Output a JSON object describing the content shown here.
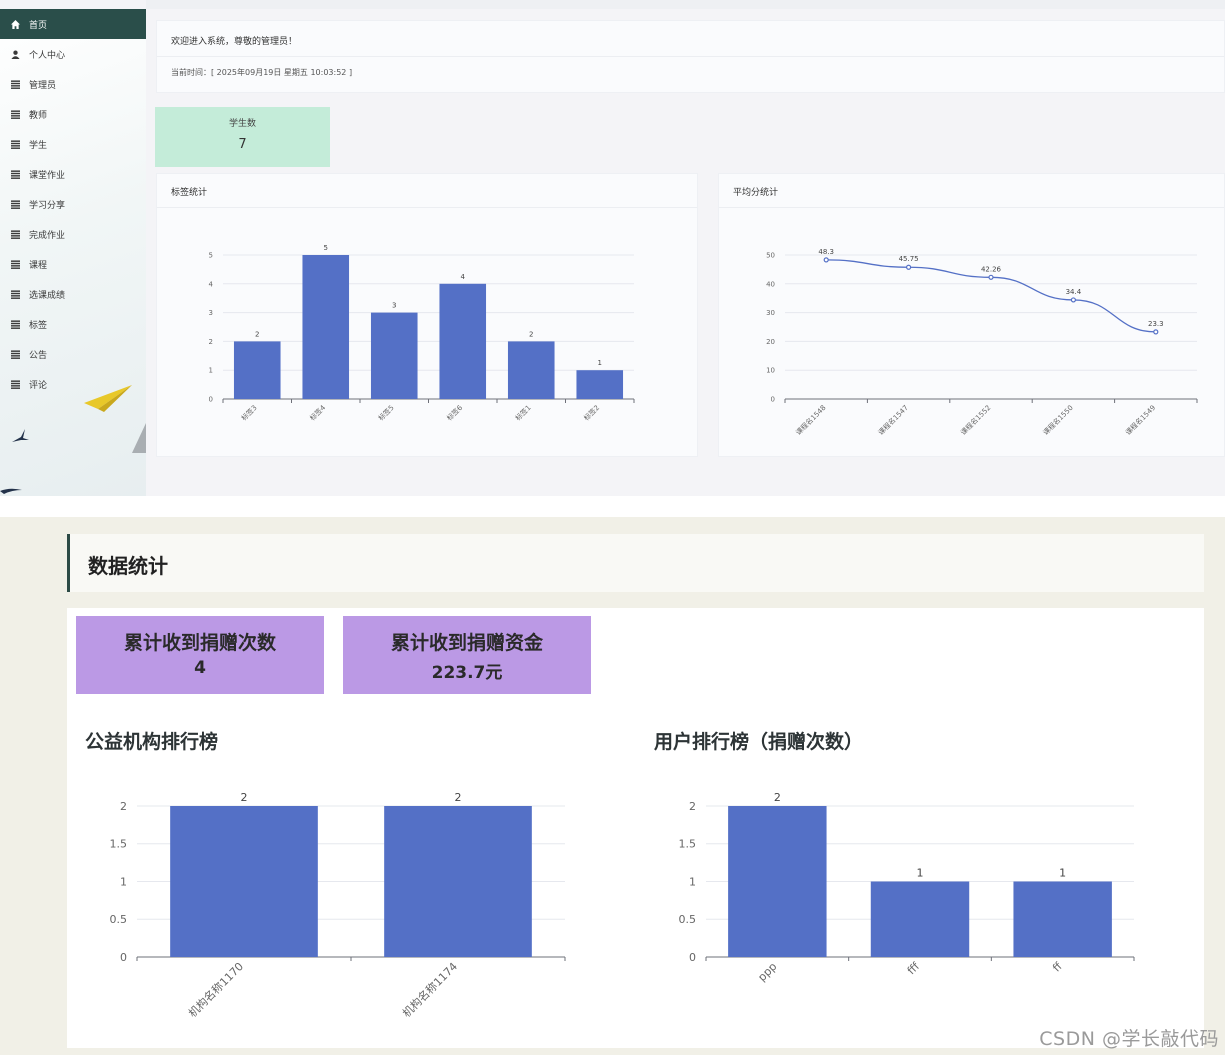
{
  "admin": {
    "sidebar": {
      "items": [
        {
          "label": "首页",
          "icon": "home-icon",
          "active": true
        },
        {
          "label": "个人中心",
          "icon": "user-icon"
        },
        {
          "label": "管理员",
          "icon": "list-icon"
        },
        {
          "label": "教师",
          "icon": "list-icon"
        },
        {
          "label": "学生",
          "icon": "list-icon"
        },
        {
          "label": "课堂作业",
          "icon": "list-icon"
        },
        {
          "label": "学习分享",
          "icon": "list-icon"
        },
        {
          "label": "完成作业",
          "icon": "list-icon"
        },
        {
          "label": "课程",
          "icon": "list-icon"
        },
        {
          "label": "选课成绩",
          "icon": "list-icon"
        },
        {
          "label": "标签",
          "icon": "list-icon"
        },
        {
          "label": "公告",
          "icon": "list-icon"
        },
        {
          "label": "评论",
          "icon": "list-icon"
        }
      ]
    },
    "welcome": {
      "greeting": "欢迎进入系统，尊敬的管理员！",
      "time": "当前时间：[ 2025年09月19日 星期五 10:03:52 ]"
    },
    "stat": {
      "label": "学生数",
      "value": "7"
    },
    "tag_panel": {
      "title": "标签统计"
    },
    "avg_panel": {
      "title": "平均分统计"
    }
  },
  "donation": {
    "section_title": "数据统计",
    "kpi_count": {
      "label": "累计收到捐赠次数",
      "value": "4"
    },
    "kpi_money": {
      "label": "累计收到捐赠资金",
      "value": "223.7元"
    },
    "org_rank_title": "公益机构排行榜",
    "user_rank_title": "用户排行榜（捐赠次数）"
  },
  "watermark": "CSDN @学长敲代码",
  "colors": {
    "bar": "#5470c6",
    "active_nav": "#2a4e4a",
    "stat_green": "#c4ecd9",
    "kpi_purple": "#bb99e5"
  },
  "chart_data": [
    {
      "id": "tags",
      "type": "bar",
      "categories": [
        "标签3",
        "标签4",
        "标签5",
        "标签6",
        "标签1",
        "标签2"
      ],
      "values": [
        2,
        5,
        3,
        4,
        2,
        1
      ],
      "ylim": [
        0,
        5
      ],
      "yticks": [
        0,
        1,
        2,
        3,
        4,
        5
      ],
      "data_labels": true
    },
    {
      "id": "avg",
      "type": "line",
      "categories": [
        "课程名1548",
        "课程名1547",
        "课程名1552",
        "课程名1550",
        "课程名1549"
      ],
      "values": [
        48.3,
        45.75,
        42.26,
        34.4,
        23.3
      ],
      "ylim": [
        0,
        50
      ],
      "yticks": [
        0,
        10,
        20,
        30,
        40,
        50
      ],
      "data_labels": true
    },
    {
      "id": "org",
      "type": "bar",
      "categories": [
        "机构名称1170",
        "机构名称1174"
      ],
      "values": [
        2,
        2
      ],
      "ylim": [
        0,
        2
      ],
      "yticks": [
        0,
        0.5,
        1,
        1.5,
        2
      ],
      "data_labels": true
    },
    {
      "id": "user",
      "type": "bar",
      "categories": [
        "ppp",
        "fff",
        "ff"
      ],
      "values": [
        2,
        1,
        1
      ],
      "ylim": [
        0,
        2
      ],
      "yticks": [
        0,
        0.5,
        1,
        1.5,
        2
      ],
      "data_labels": true
    }
  ]
}
